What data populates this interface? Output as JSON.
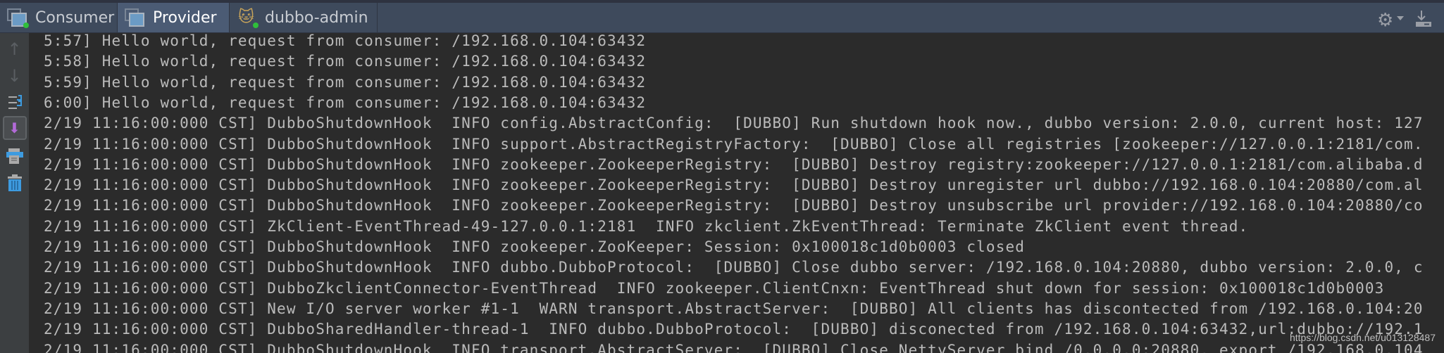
{
  "tabs": [
    {
      "label": "Consumer",
      "icon": "run-config-icon",
      "active": false
    },
    {
      "label": "Provider",
      "icon": "run-config-icon",
      "active": true
    },
    {
      "label": "dubbo-admin",
      "icon": "tomcat-icon",
      "active": false
    }
  ],
  "toolbar_icons": [
    "up-arrow-icon",
    "down-arrow-icon",
    "soft-wrap-icon",
    "scroll-to-end-icon",
    "print-icon",
    "clear-all-icon",
    "settings-gear-icon",
    "hide-download-icon"
  ],
  "console_lines": [
    "5:57] Hello world, request from consumer: /192.168.0.104:63432",
    "5:58] Hello world, request from consumer: /192.168.0.104:63432",
    "5:59] Hello world, request from consumer: /192.168.0.104:63432",
    "6:00] Hello world, request from consumer: /192.168.0.104:63432",
    "2/19 11:16:00:000 CST] DubboShutdownHook  INFO config.AbstractConfig:  [DUBBO] Run shutdown hook now., dubbo version: 2.0.0, current host: 127",
    "2/19 11:16:00:000 CST] DubboShutdownHook  INFO support.AbstractRegistryFactory:  [DUBBO] Close all registries [zookeeper://127.0.0.1:2181/com.",
    "2/19 11:16:00:000 CST] DubboShutdownHook  INFO zookeeper.ZookeeperRegistry:  [DUBBO] Destroy registry:zookeeper://127.0.0.1:2181/com.alibaba.d",
    "2/19 11:16:00:000 CST] DubboShutdownHook  INFO zookeeper.ZookeeperRegistry:  [DUBBO] Destroy unregister url dubbo://192.168.0.104:20880/com.al",
    "2/19 11:16:00:000 CST] DubboShutdownHook  INFO zookeeper.ZookeeperRegistry:  [DUBBO] Destroy unsubscribe url provider://192.168.0.104:20880/co",
    "2/19 11:16:00:000 CST] ZkClient-EventThread-49-127.0.0.1:2181  INFO zkclient.ZkEventThread: Terminate ZkClient event thread.",
    "2/19 11:16:00:000 CST] DubboShutdownHook  INFO zookeeper.ZooKeeper: Session: 0x100018c1d0b0003 closed",
    "2/19 11:16:00:000 CST] DubboShutdownHook  INFO dubbo.DubboProtocol:  [DUBBO] Close dubbo server: /192.168.0.104:20880, dubbo version: 2.0.0, c",
    "2/19 11:16:00:000 CST] DubboZkclientConnector-EventThread  INFO zookeeper.ClientCnxn: EventThread shut down for session: 0x100018c1d0b0003",
    "2/19 11:16:00:000 CST] New I/O server worker #1-1  WARN transport.AbstractServer:  [DUBBO] All clients has discontected from /192.168.0.104:20",
    "2/19 11:16:00:000 CST] DubboSharedHandler-thread-1  INFO dubbo.DubboProtocol:  [DUBBO] disconected from /192.168.0.104:63432,url:dubbo://192.1",
    "2/19 11:16:00:000 CST] DubboShutdownHook  INFO transport.AbstractServer:  [DUBBO] Close NettyServer bind /0.0.0.0:20880, export /192.168.0.104"
  ],
  "watermark": "https://blog.csdn.net/u013128487",
  "colors": {
    "tabbar": "#3e4a5c",
    "active_tab": "#4b5b74",
    "console_bg": "#2b2b2b",
    "text": "#bbbbbb",
    "toolbar": "#3c3f41"
  }
}
